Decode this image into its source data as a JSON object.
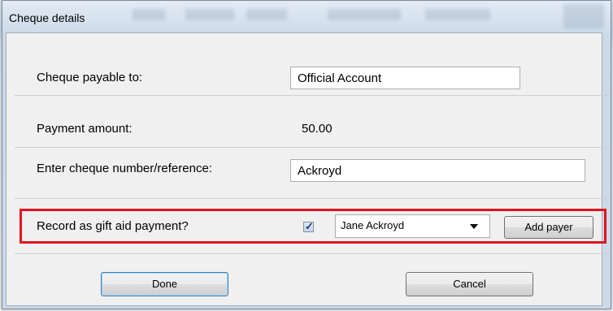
{
  "window": {
    "title": "Cheque details"
  },
  "form": {
    "payable_label": "Cheque payable to:",
    "payable_value": "Official Account",
    "amount_label": "Payment amount:",
    "amount_value": "50.00",
    "reference_label": "Enter cheque number/reference:",
    "reference_value": "Ackroyd",
    "gift_aid_label": "Record as gift aid payment?",
    "gift_aid_checked": true,
    "payer_selected": "Jane Ackroyd",
    "add_payer_label": "Add payer"
  },
  "buttons": {
    "done_label": "Done",
    "cancel_label": "Cancel"
  },
  "colors": {
    "highlight": "#e0141e",
    "default_button_border": "#3c7fb1"
  }
}
